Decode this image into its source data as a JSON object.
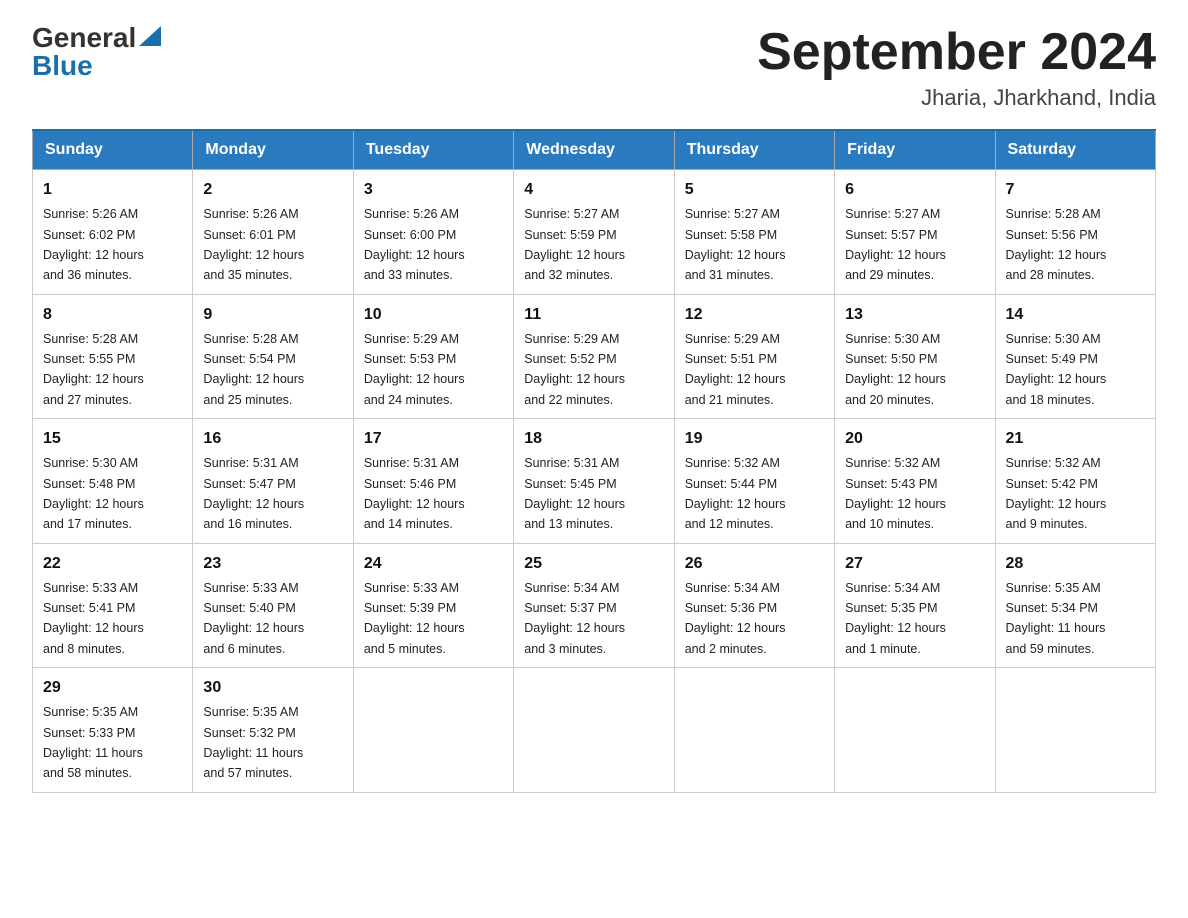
{
  "header": {
    "logo": {
      "general": "General",
      "blue": "Blue"
    },
    "title": "September 2024",
    "location": "Jharia, Jharkhand, India"
  },
  "days_of_week": [
    "Sunday",
    "Monday",
    "Tuesday",
    "Wednesday",
    "Thursday",
    "Friday",
    "Saturday"
  ],
  "weeks": [
    [
      {
        "day": "1",
        "sunrise": "5:26 AM",
        "sunset": "6:02 PM",
        "daylight": "12 hours and 36 minutes."
      },
      {
        "day": "2",
        "sunrise": "5:26 AM",
        "sunset": "6:01 PM",
        "daylight": "12 hours and 35 minutes."
      },
      {
        "day": "3",
        "sunrise": "5:26 AM",
        "sunset": "6:00 PM",
        "daylight": "12 hours and 33 minutes."
      },
      {
        "day": "4",
        "sunrise": "5:27 AM",
        "sunset": "5:59 PM",
        "daylight": "12 hours and 32 minutes."
      },
      {
        "day": "5",
        "sunrise": "5:27 AM",
        "sunset": "5:58 PM",
        "daylight": "12 hours and 31 minutes."
      },
      {
        "day": "6",
        "sunrise": "5:27 AM",
        "sunset": "5:57 PM",
        "daylight": "12 hours and 29 minutes."
      },
      {
        "day": "7",
        "sunrise": "5:28 AM",
        "sunset": "5:56 PM",
        "daylight": "12 hours and 28 minutes."
      }
    ],
    [
      {
        "day": "8",
        "sunrise": "5:28 AM",
        "sunset": "5:55 PM",
        "daylight": "12 hours and 27 minutes."
      },
      {
        "day": "9",
        "sunrise": "5:28 AM",
        "sunset": "5:54 PM",
        "daylight": "12 hours and 25 minutes."
      },
      {
        "day": "10",
        "sunrise": "5:29 AM",
        "sunset": "5:53 PM",
        "daylight": "12 hours and 24 minutes."
      },
      {
        "day": "11",
        "sunrise": "5:29 AM",
        "sunset": "5:52 PM",
        "daylight": "12 hours and 22 minutes."
      },
      {
        "day": "12",
        "sunrise": "5:29 AM",
        "sunset": "5:51 PM",
        "daylight": "12 hours and 21 minutes."
      },
      {
        "day": "13",
        "sunrise": "5:30 AM",
        "sunset": "5:50 PM",
        "daylight": "12 hours and 20 minutes."
      },
      {
        "day": "14",
        "sunrise": "5:30 AM",
        "sunset": "5:49 PM",
        "daylight": "12 hours and 18 minutes."
      }
    ],
    [
      {
        "day": "15",
        "sunrise": "5:30 AM",
        "sunset": "5:48 PM",
        "daylight": "12 hours and 17 minutes."
      },
      {
        "day": "16",
        "sunrise": "5:31 AM",
        "sunset": "5:47 PM",
        "daylight": "12 hours and 16 minutes."
      },
      {
        "day": "17",
        "sunrise": "5:31 AM",
        "sunset": "5:46 PM",
        "daylight": "12 hours and 14 minutes."
      },
      {
        "day": "18",
        "sunrise": "5:31 AM",
        "sunset": "5:45 PM",
        "daylight": "12 hours and 13 minutes."
      },
      {
        "day": "19",
        "sunrise": "5:32 AM",
        "sunset": "5:44 PM",
        "daylight": "12 hours and 12 minutes."
      },
      {
        "day": "20",
        "sunrise": "5:32 AM",
        "sunset": "5:43 PM",
        "daylight": "12 hours and 10 minutes."
      },
      {
        "day": "21",
        "sunrise": "5:32 AM",
        "sunset": "5:42 PM",
        "daylight": "12 hours and 9 minutes."
      }
    ],
    [
      {
        "day": "22",
        "sunrise": "5:33 AM",
        "sunset": "5:41 PM",
        "daylight": "12 hours and 8 minutes."
      },
      {
        "day": "23",
        "sunrise": "5:33 AM",
        "sunset": "5:40 PM",
        "daylight": "12 hours and 6 minutes."
      },
      {
        "day": "24",
        "sunrise": "5:33 AM",
        "sunset": "5:39 PM",
        "daylight": "12 hours and 5 minutes."
      },
      {
        "day": "25",
        "sunrise": "5:34 AM",
        "sunset": "5:37 PM",
        "daylight": "12 hours and 3 minutes."
      },
      {
        "day": "26",
        "sunrise": "5:34 AM",
        "sunset": "5:36 PM",
        "daylight": "12 hours and 2 minutes."
      },
      {
        "day": "27",
        "sunrise": "5:34 AM",
        "sunset": "5:35 PM",
        "daylight": "12 hours and 1 minute."
      },
      {
        "day": "28",
        "sunrise": "5:35 AM",
        "sunset": "5:34 PM",
        "daylight": "11 hours and 59 minutes."
      }
    ],
    [
      {
        "day": "29",
        "sunrise": "5:35 AM",
        "sunset": "5:33 PM",
        "daylight": "11 hours and 58 minutes."
      },
      {
        "day": "30",
        "sunrise": "5:35 AM",
        "sunset": "5:32 PM",
        "daylight": "11 hours and 57 minutes."
      },
      null,
      null,
      null,
      null,
      null
    ]
  ],
  "labels": {
    "sunrise": "Sunrise:",
    "sunset": "Sunset:",
    "daylight": "Daylight:"
  }
}
